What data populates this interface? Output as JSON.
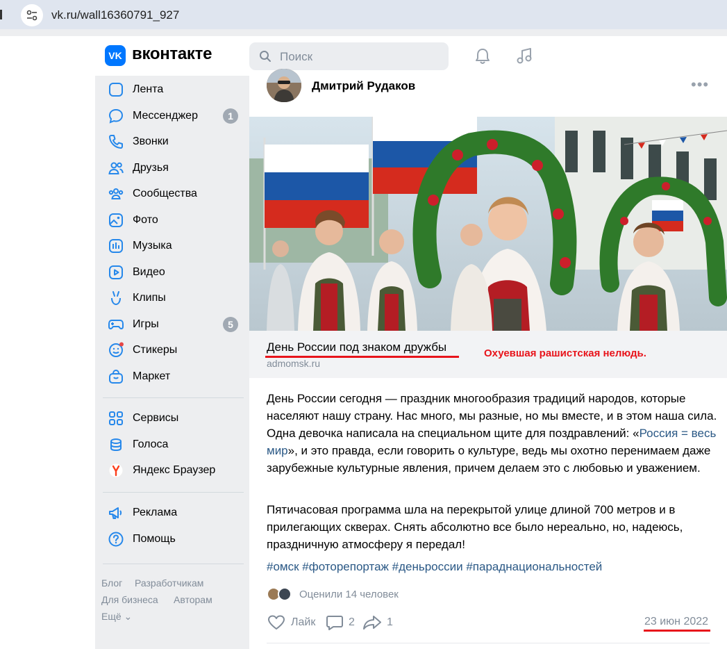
{
  "browser": {
    "url": "vk.ru/wall16360791_927"
  },
  "header": {
    "logo_badge": "VK",
    "logo_text": "вконтакте",
    "search_placeholder": "Поиск"
  },
  "sidebar": {
    "items": [
      {
        "label": "Лента",
        "icon": "news-icon"
      },
      {
        "label": "Мессенджер",
        "icon": "messenger-icon",
        "badge": "1"
      },
      {
        "label": "Звонки",
        "icon": "phone-icon"
      },
      {
        "label": "Друзья",
        "icon": "friends-icon"
      },
      {
        "label": "Сообщества",
        "icon": "communities-icon"
      },
      {
        "label": "Фото",
        "icon": "photo-icon"
      },
      {
        "label": "Музыка",
        "icon": "music-icon"
      },
      {
        "label": "Видео",
        "icon": "video-icon"
      },
      {
        "label": "Клипы",
        "icon": "clips-icon"
      },
      {
        "label": "Игры",
        "icon": "games-icon",
        "badge": "5"
      },
      {
        "label": "Стикеры",
        "icon": "stickers-icon"
      },
      {
        "label": "Маркет",
        "icon": "market-icon"
      }
    ],
    "items2": [
      {
        "label": "Сервисы",
        "icon": "services-icon"
      },
      {
        "label": "Голоса",
        "icon": "votes-icon"
      },
      {
        "label": "Яндекс Браузер",
        "icon": "yandex-icon"
      }
    ],
    "items3": [
      {
        "label": "Реклама",
        "icon": "ads-icon"
      },
      {
        "label": "Помощь",
        "icon": "help-icon"
      }
    ],
    "footer": {
      "blog": "Блог",
      "developers": "Разработчикам",
      "business": "Для бизнеса",
      "authors": "Авторам",
      "more": "Ещё ⌄"
    }
  },
  "post": {
    "author": "Дмитрий Рудаков",
    "more": "•••",
    "link_card": {
      "title": "День России под знаком дружбы",
      "source": "admomsk.ru"
    },
    "annotation": "Охуевшая рашистская нелюдь.",
    "paragraph1_a": "День России сегодня — праздник многообразия традиций народов, которые населяют нашу страну. Нас много, мы разные, но мы вместе, и в этом наша сила. Одна девочка написала на специальном щите для поздравлений: «",
    "paragraph1_link": "Россия = весь мир",
    "paragraph1_b": "», и это правда, если говорить о культуре, ведь мы охотно перенимаем даже зарубежные культурные явления, причем делаем это с любовью и уважением.",
    "paragraph2": "Пятичасовая программа шла на перекрытой улице длиной 700 метров и в прилегающих скверах. Снять абсолютно все было нереально, но, надеюсь, праздничную атмосферу я передал!",
    "hashtags": "#омск #фоторепортаж #деньроссии #параднациональностей",
    "likers_text": "Оценили 14 человек",
    "actions": {
      "like_label": "Лайк",
      "comments_count": "2",
      "shares_count": "1"
    },
    "date": "23 июн 2022"
  },
  "colors": {
    "accent": "#0077ff",
    "link": "#2a5885",
    "annotation_red": "#e8141b",
    "muted": "#818c99"
  }
}
